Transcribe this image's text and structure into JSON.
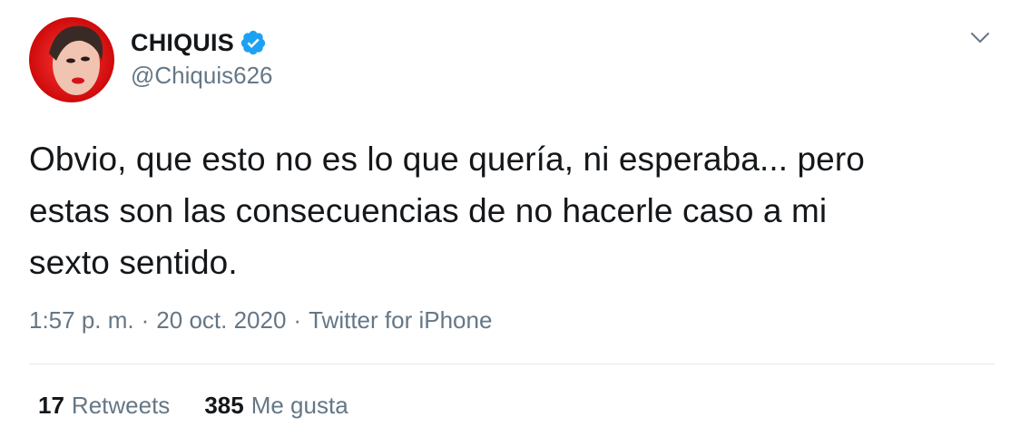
{
  "user": {
    "display_name": "CHIQUIS",
    "handle": "@Chiquis626",
    "verified": true,
    "verified_icon": "verified-badge-icon",
    "verified_color": "#1da1f2"
  },
  "tweet": {
    "text": "Obvio, que esto no es lo que quería, ni esperaba... pero\nestas son las consecuencias de no hacerle caso a mi\nsexto sentido."
  },
  "meta": {
    "time": "1:57 p. m.",
    "separator": "·",
    "date": "20 oct. 2020",
    "source": "Twitter for iPhone"
  },
  "stats": {
    "retweets_count": "17",
    "retweets_label": "Retweets",
    "likes_count": "385",
    "likes_label": "Me gusta"
  },
  "menu": {
    "icon": "chevron-down-icon"
  },
  "colors": {
    "text_primary": "#14171a",
    "text_secondary": "#657786",
    "divider": "#e6ecf0",
    "brand_blue": "#1da1f2"
  }
}
